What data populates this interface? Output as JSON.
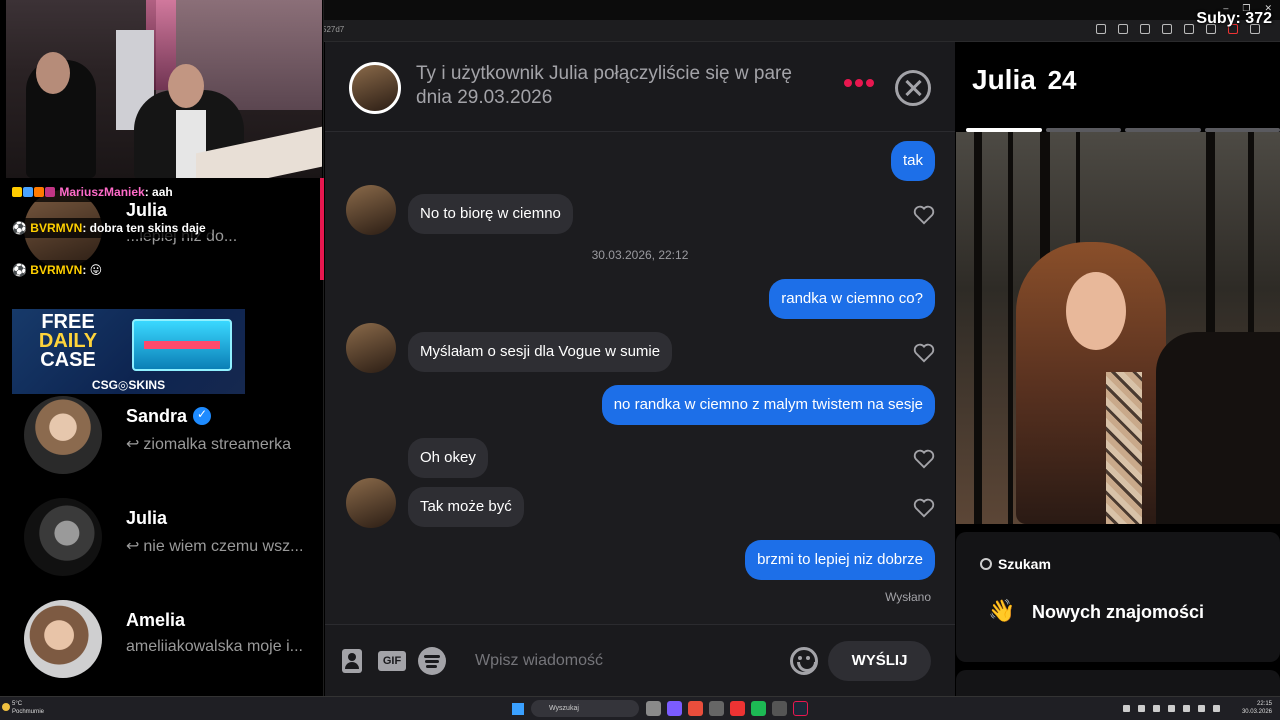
{
  "overlay": {
    "subs_text": "Suby: 372"
  },
  "browser": {
    "url_fragment": "527d7",
    "controls": [
      "–",
      "❐",
      "✕"
    ]
  },
  "sidebar": {
    "items": [
      {
        "name": "Julia",
        "preview": "...lepiej niz do...",
        "active": true
      },
      {
        "name": "Sandra",
        "preview": "ziomalka streamerka",
        "verified": true,
        "reply": true
      },
      {
        "name": "Julia",
        "preview": "nie wiem czemu wsz...",
        "reply": true
      },
      {
        "name": "Amelia",
        "preview": "ameliiakowalska moje i..."
      }
    ]
  },
  "stream_chat": [
    {
      "user": "MariuszManiek",
      "text": ": aah"
    },
    {
      "user": "BVRMVN",
      "text": ": dobra ten skins daje"
    },
    {
      "user": "BVRMVN",
      "text": ": 😛"
    }
  ],
  "ad": {
    "line1": "FREE",
    "line2": "DAILY",
    "line3": "CASE",
    "brand": "CSG◎SKINS"
  },
  "conversation": {
    "header_text": "Ty i użytkownik Julia połączyliście się w parę dnia 29.03.2026",
    "messages": [
      {
        "dir": "out",
        "text": "tak"
      },
      {
        "dir": "in",
        "text": "No to biorę w ciemno"
      },
      {
        "dir": "out",
        "text": "randka w ciemno co?"
      },
      {
        "dir": "in",
        "text": "Myślałam o sesji dla Vogue w sumie"
      },
      {
        "dir": "out",
        "text": "no randka w ciemno z malym twistem na sesje"
      },
      {
        "dir": "in",
        "text": "Oh okey"
      },
      {
        "dir": "in",
        "text": "Tak może być"
      },
      {
        "dir": "out",
        "text": "brzmi to lepiej niz dobrze"
      }
    ],
    "timestamp": "30.03.2026, 22:12",
    "sent_label": "Wysłano",
    "composer": {
      "placeholder": "Wpisz wiadomość",
      "gif_label": "GIF",
      "send_label": "WYŚLIJ"
    }
  },
  "profile": {
    "name": "Julia",
    "age": "24",
    "looking_for_label": "Szukam",
    "looking_for_value": "Nowych znajomości",
    "looking_for_emoji": "👋",
    "story_count": 4,
    "story_active": 1
  },
  "taskbar": {
    "weather_temp": "5°C",
    "weather_desc": "Pochmurnie",
    "search_label": "Wyszukaj",
    "time": "22:15",
    "date": "30.03.2026"
  },
  "colors": {
    "accent": "#e8174f",
    "outgoing": "#1d6fe8",
    "incoming": "#2e2e33",
    "verified": "#1e8bff"
  }
}
